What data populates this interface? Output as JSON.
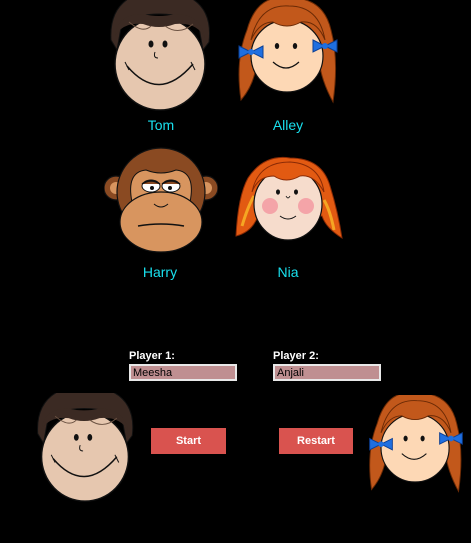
{
  "characters": [
    {
      "name": "Tom"
    },
    {
      "name": "Alley"
    },
    {
      "name": "Harry"
    },
    {
      "name": "Nia"
    }
  ],
  "players": {
    "player1": {
      "label": "Player 1:",
      "value": "Meesha",
      "avatar": "Tom"
    },
    "player2": {
      "label": "Player 2:",
      "value": "Anjali",
      "avatar": "Alley"
    }
  },
  "buttons": {
    "start": "Start",
    "restart": "Restart"
  },
  "colors": {
    "background": "#000000",
    "name_text": "#19e0ee",
    "button": "#d9534f",
    "input_bg": "#bf8f91"
  }
}
